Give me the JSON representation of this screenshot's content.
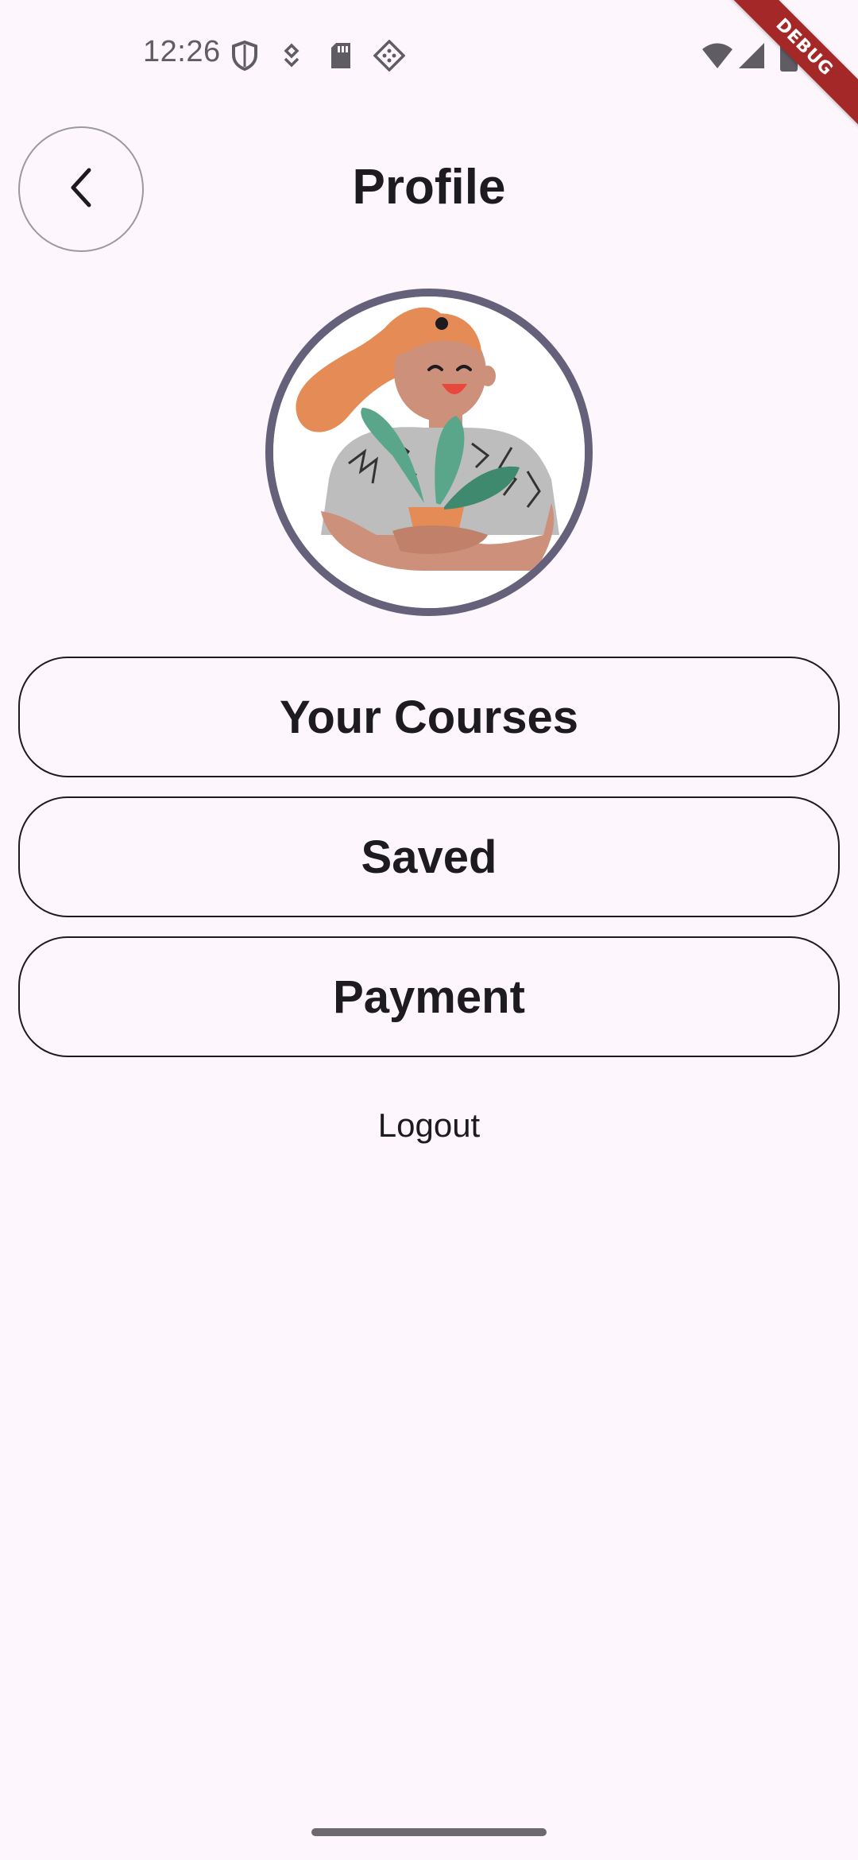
{
  "status_bar": {
    "time": "12:26",
    "icons": [
      "shield-icon",
      "location-icon",
      "sd-card-icon",
      "app-icon",
      "wifi-icon",
      "signal-icon",
      "battery-icon"
    ]
  },
  "debug_banner": "DEBUG",
  "header": {
    "back_icon": "chevron-left-icon",
    "title": "Profile"
  },
  "avatar": {
    "border_color": "#66617a",
    "description_icon": "profile-avatar-illustration"
  },
  "menu": {
    "items": [
      {
        "label": "Your Courses"
      },
      {
        "label": "Saved"
      },
      {
        "label": "Payment"
      }
    ],
    "logout_label": "Logout"
  },
  "colors": {
    "background": "#fdf7fd",
    "text": "#1d1b20",
    "debug": "#a52828"
  }
}
